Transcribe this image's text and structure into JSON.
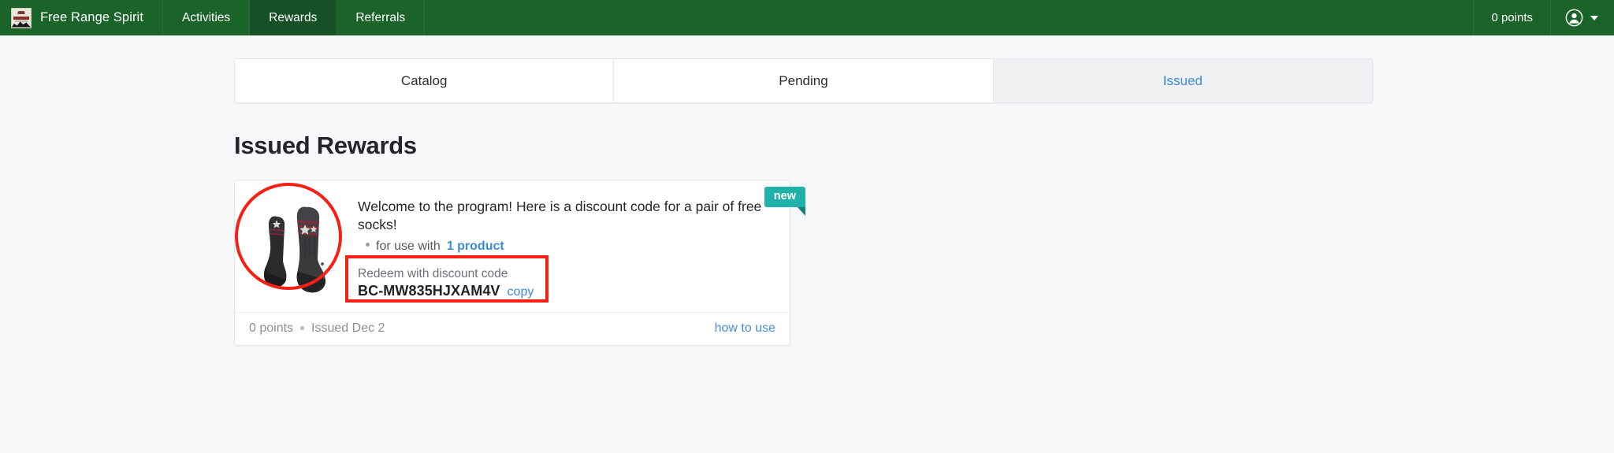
{
  "header": {
    "brand_name": "Free Range Spirit",
    "brand_logo_icon": "crest-logo-icon",
    "nav_items": [
      {
        "label": "Activities",
        "active": false
      },
      {
        "label": "Rewards",
        "active": true
      },
      {
        "label": "Referrals",
        "active": false
      }
    ],
    "points_label": "0 points",
    "account_icon": "user-avatar-icon",
    "caret_icon": "chevron-down-icon",
    "background_color": "#1a6329",
    "active_background_color": "#155026"
  },
  "tabs": [
    {
      "label": "Catalog",
      "active": false
    },
    {
      "label": "Pending",
      "active": false
    },
    {
      "label": "Issued",
      "active": true
    }
  ],
  "page": {
    "title": "Issued Rewards",
    "background_color": "#f7f8fa"
  },
  "reward_card": {
    "badge_label": "new",
    "badge_color": "#20b2aa",
    "thumbnail_icon": "wool-socks-image",
    "description": "Welcome to the program! Here is a discount code for a pair of free socks!",
    "usage_prefix": "for use with",
    "usage_link": "1 product",
    "redeem_label": "Redeem with discount code",
    "discount_code": "BC-MW835HJXAM4V",
    "copy_label": "copy",
    "points_label": "0 points",
    "issued_label": "Issued Dec 2",
    "how_to_use_label": "how to use",
    "link_color": "#3b8bd9"
  },
  "annotations": {
    "highlight_color": "#f72015",
    "ellipse_target": "reward-thumbnail",
    "rectangle_target": "discount-code-block"
  }
}
